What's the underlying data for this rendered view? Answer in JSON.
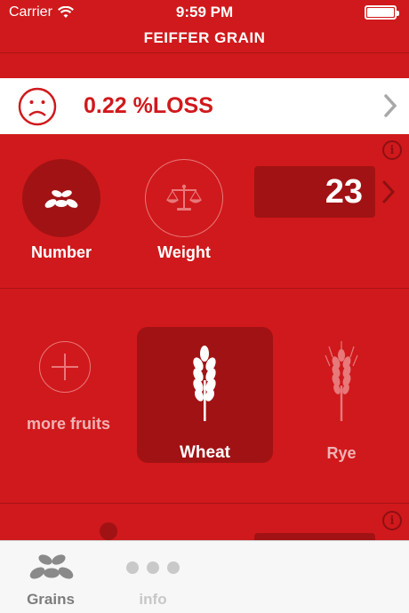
{
  "status_bar": {
    "carrier": "Carrier",
    "time": "9:59 PM"
  },
  "nav": {
    "title": "FEIFFER GRAIN"
  },
  "loss": {
    "value": "0.22 %LOSS",
    "mood_icon": "sad-face-icon"
  },
  "measure": {
    "modes": [
      {
        "label": "Number",
        "icon": "grains-icon",
        "selected": true
      },
      {
        "label": "Weight",
        "icon": "scale-icon",
        "selected": false
      }
    ],
    "count": "23"
  },
  "grains": {
    "items": [
      {
        "label": "more fruits",
        "icon": "plus-icon"
      },
      {
        "label": "Wheat",
        "icon": "wheat-icon",
        "selected": true
      },
      {
        "label": "Rye",
        "icon": "rye-icon"
      }
    ]
  },
  "tabs": [
    {
      "label": "Grains",
      "icon": "grains-tab-icon",
      "active": true
    },
    {
      "label": "info",
      "icon": "more-dots-icon",
      "active": false
    }
  ],
  "colors": {
    "primary": "#d0191c",
    "dark": "#a11214",
    "tab_bg": "#f7f7f7"
  }
}
